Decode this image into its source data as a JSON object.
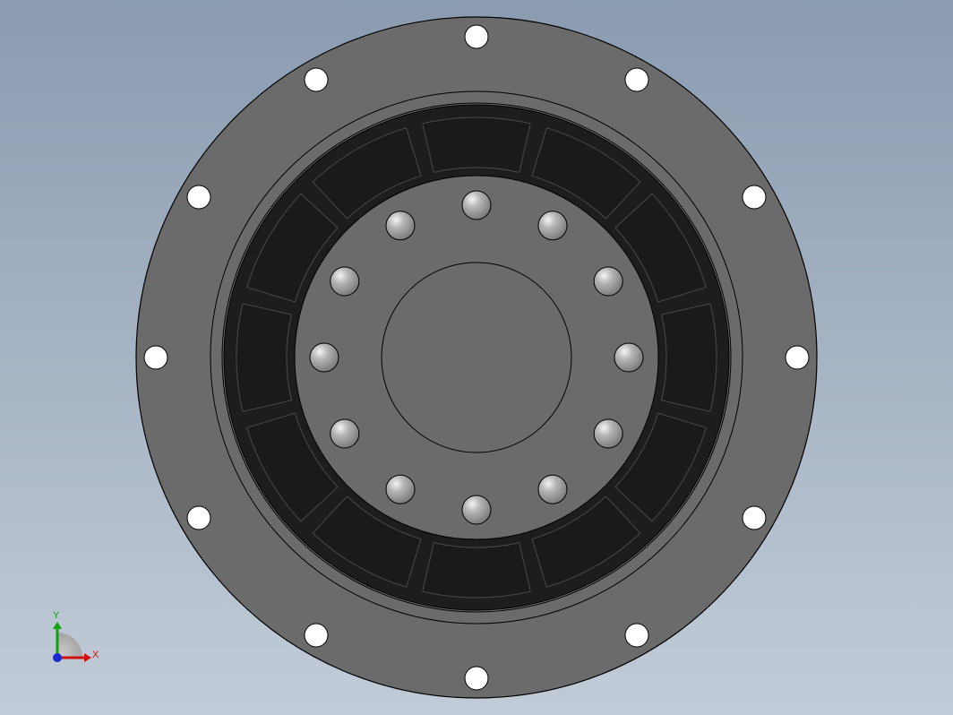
{
  "viewport": {
    "background_top": "#8a9bb0",
    "background_bottom": "#c2ccd8"
  },
  "model": {
    "flange_color": "#6b6b6b",
    "ring_color": "#1d1d1d",
    "segment_color": "#1a1a1a",
    "edge_color": "#000000",
    "hole_color": "#ffffff",
    "flange_hole_count": 12,
    "bolt_count": 12,
    "magnet_segment_count": 12
  },
  "triad": {
    "x_label": "X",
    "y_label": "Y",
    "x_color": "#d01010",
    "y_color": "#10a010",
    "origin_color": "#1a2ad0"
  }
}
